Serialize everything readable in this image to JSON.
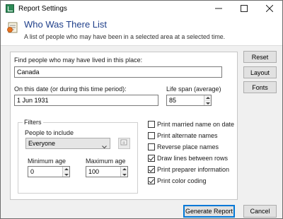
{
  "window": {
    "title": "Report Settings",
    "minimize_icon": "minimize-icon",
    "maximize_icon": "maximize-icon",
    "close_icon": "close-icon"
  },
  "header": {
    "title": "Who Was There List",
    "description": "A list of people who may have been in a selected area at a selected time.",
    "icon": "report-icon",
    "title_color": "#1f3f8a"
  },
  "form": {
    "place_label": "Find people who may have lived in this place:",
    "place_value": "Canada",
    "date_label": "On this date (or during this time period):",
    "date_value": "1 Jun 1931",
    "lifespan_label": "Life span (average)",
    "lifespan_value": "85",
    "filters": {
      "legend": "Filters",
      "people_label": "People to include",
      "people_selected": "Everyone",
      "filter_button_icon": "filter-edit-icon",
      "min_age_label": "Minimum age",
      "min_age_value": "0",
      "max_age_label": "Maximum age",
      "max_age_value": "100"
    },
    "options": [
      {
        "label": "Print married name on date",
        "checked": false
      },
      {
        "label": "Print alternate names",
        "checked": false
      },
      {
        "label": "Reverse place names",
        "checked": false
      },
      {
        "label": "Draw lines between rows",
        "checked": true
      },
      {
        "label": "Print preparer information",
        "checked": true
      },
      {
        "label": "Print color coding",
        "checked": true
      }
    ]
  },
  "side_buttons": {
    "reset": "Reset",
    "layout": "Layout",
    "fonts": "Fonts"
  },
  "footer": {
    "generate": "Generate Report",
    "cancel": "Cancel",
    "accent": "#0078d7"
  }
}
